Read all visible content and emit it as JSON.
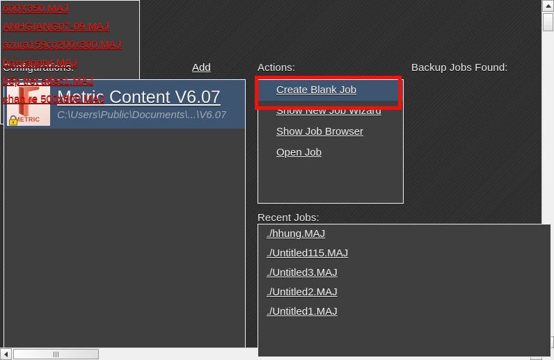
{
  "colors": {
    "accent_blue": "#3d5570",
    "highlight_red": "#fb0d08",
    "panel_bg": "#403f3f",
    "link_white": "#f2f2f2",
    "backup_link_red": "#fb1008",
    "lock_yellow": "#f2d024"
  },
  "configurations": {
    "label": "Configurations:",
    "add_label": "Add",
    "items": [
      {
        "title": "Metric Content V6.07",
        "path": "C:\\Users\\Public\\Documents\\...\\V6.07",
        "icon_word": "METRIC",
        "icon": "f-logo-icon",
        "badge": "lock-icon",
        "selected": true
      }
    ]
  },
  "actions": {
    "label": "Actions:",
    "items": [
      {
        "label": "Create Blank Job",
        "selected": true
      },
      {
        "label": "Show New Job Wizard",
        "selected": false
      },
      {
        "label": "Show Job Browser",
        "selected": false
      },
      {
        "label": "Open Job",
        "selected": false
      }
    ]
  },
  "backup_jobs": {
    "label": "Backup Jobs Found:",
    "items": [
      {
        "label": "600X350.MAJ"
      },
      {
        "label": "ANHGIANG07-09.MAJ"
      },
      {
        "label": "azura159co200x300.MAJ"
      },
      {
        "label": "boxvagotvt.MAJ"
      },
      {
        "label": "bếp tret adec1.MAJ"
      },
      {
        "label": "chan re 500x800.MAJ"
      }
    ],
    "scrollbars": {
      "vertical": {
        "up": "scroll-up-icon",
        "down": "scroll-down-icon"
      },
      "horizontal": {
        "left": "scroll-left-icon",
        "right": "scroll-right-icon"
      }
    }
  },
  "recent_jobs": {
    "label": "Recent Jobs:",
    "items": [
      {
        "label": "./hhung.MAJ"
      },
      {
        "label": "./Untitled115.MAJ"
      },
      {
        "label": "./Untitled3.MAJ"
      },
      {
        "label": "./Untitled2.MAJ"
      },
      {
        "label": "./Untitled1.MAJ"
      }
    ]
  }
}
